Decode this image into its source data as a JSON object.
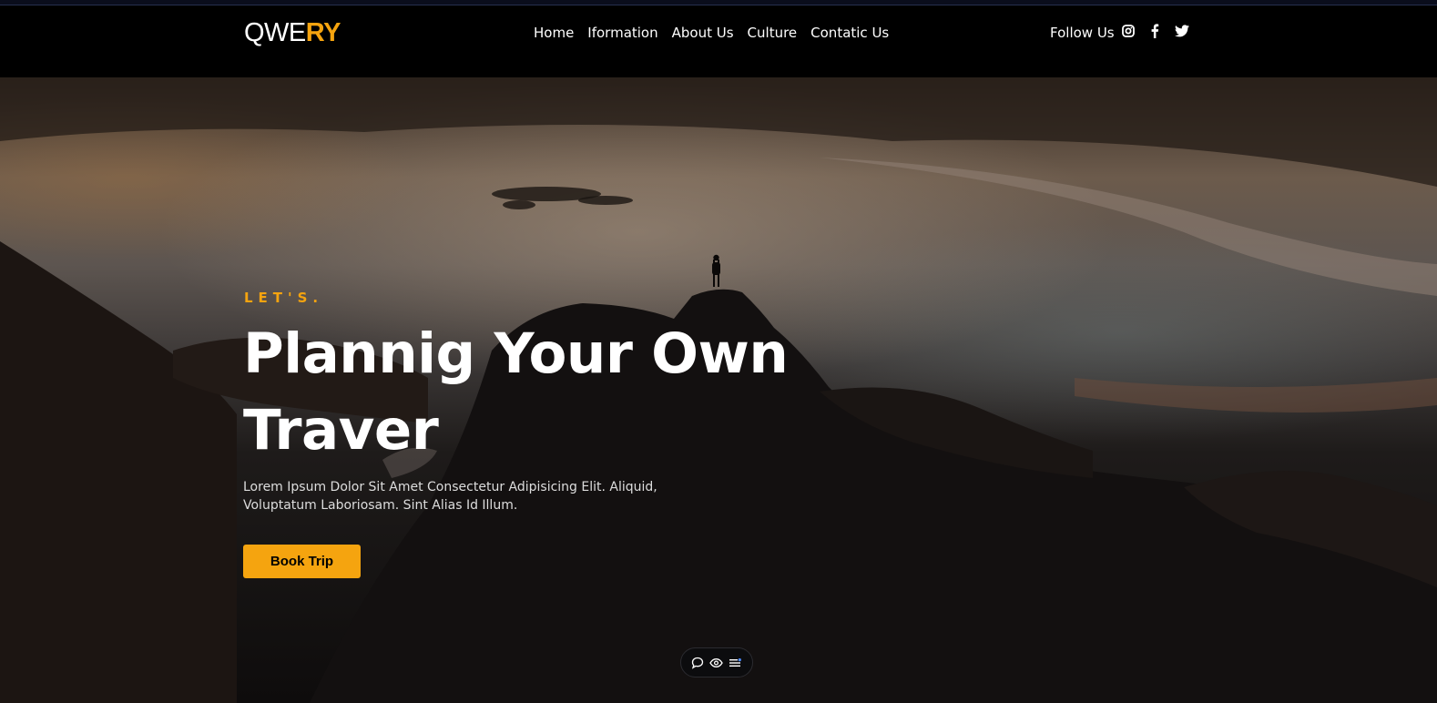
{
  "brand": {
    "logo_part1": "QWE",
    "logo_part2": "RY",
    "accent": "#f5a40f"
  },
  "nav": {
    "links": [
      "Home",
      "Iformation",
      "About Us",
      "Culture",
      "Contatic Us"
    ],
    "follow_label": "Follow Us",
    "social_icons": [
      "instagram-icon",
      "facebook-icon",
      "twitter-icon"
    ]
  },
  "hero": {
    "eyebrow": "LET'S.",
    "headline": "Plannig Your Own Traver",
    "description": "Lorem Ipsum Dolor Sit Amet Consectetur Adipisicing Elit. Aliquid, Voluptatum Laboriosam. Sint Alias Id Illum.",
    "cta_label": "Book Trip"
  },
  "floating_toolbar": {
    "icons": [
      "chat-bubble-icon",
      "eye-icon",
      "menu-list-icon"
    ]
  }
}
